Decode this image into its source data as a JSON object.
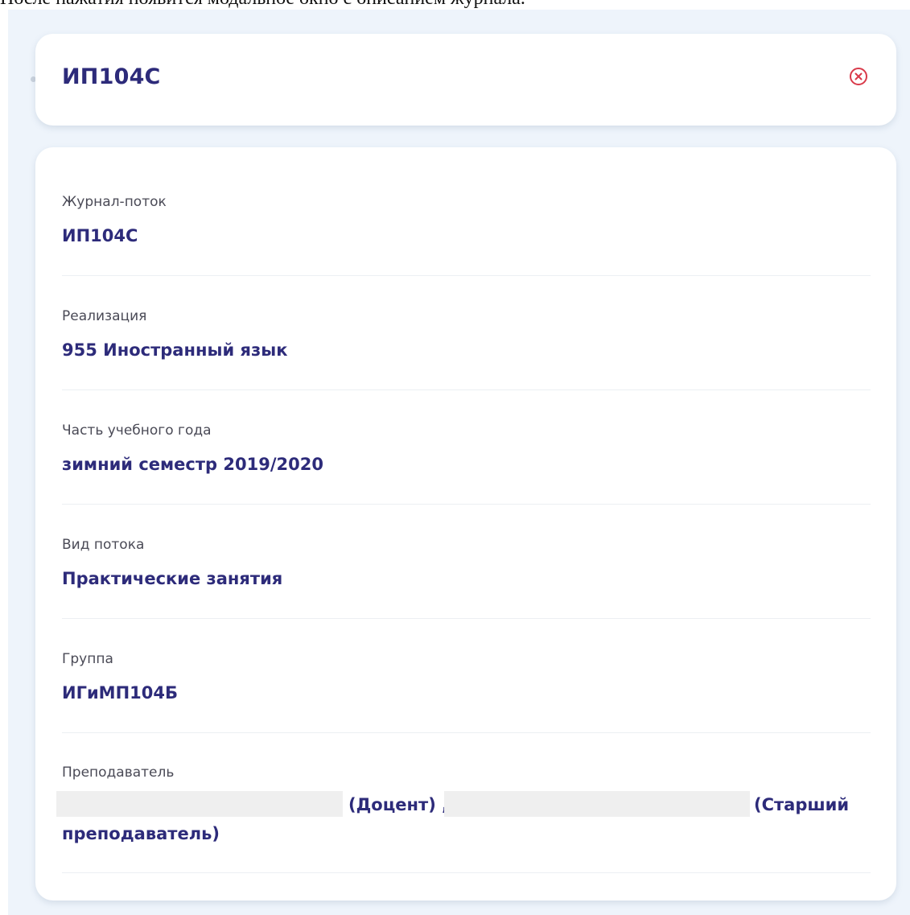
{
  "caption": "После нажатия появится модальное окно с описанием журнала.",
  "modal": {
    "title": "ИП104С",
    "close_icon": "close-circle-icon",
    "accent_color": "#2d2b7a",
    "close_color": "#d93a4a"
  },
  "fields": {
    "journal": {
      "label": "Журнал-поток",
      "value": "ИП104С"
    },
    "implementation": {
      "label": "Реализация",
      "value": "955 Иностранный язык"
    },
    "term": {
      "label": "Часть учебного года",
      "value": "зимний семестр 2019/2020"
    },
    "stream_type": {
      "label": "Вид потока",
      "value": "Практические занятия"
    },
    "group": {
      "label": "Группа",
      "value": "ИГиМП104Б"
    },
    "teacher": {
      "label": "Преподаватель",
      "role_1": "(Доцент) ,",
      "role_2": "(Старший",
      "role_2_cont": "преподаватель)"
    }
  }
}
